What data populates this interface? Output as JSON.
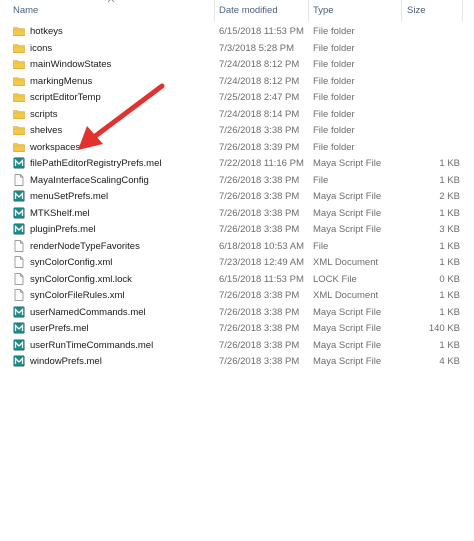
{
  "columns": {
    "name": "Name",
    "date": "Date modified",
    "type": "Type",
    "size": "Size"
  },
  "files": [
    {
      "name": "hotkeys",
      "date": "6/15/2018 11:53 PM",
      "type": "File folder",
      "size": "",
      "icon": "folder-icon"
    },
    {
      "name": "icons",
      "date": "7/3/2018 5:28 PM",
      "type": "File folder",
      "size": "",
      "icon": "folder-icon"
    },
    {
      "name": "mainWindowStates",
      "date": "7/24/2018 8:12 PM",
      "type": "File folder",
      "size": "",
      "icon": "folder-icon"
    },
    {
      "name": "markingMenus",
      "date": "7/24/2018 8:12 PM",
      "type": "File folder",
      "size": "",
      "icon": "folder-icon"
    },
    {
      "name": "scriptEditorTemp",
      "date": "7/25/2018 2:47 PM",
      "type": "File folder",
      "size": "",
      "icon": "folder-icon"
    },
    {
      "name": "scripts",
      "date": "7/24/2018 8:14 PM",
      "type": "File folder",
      "size": "",
      "icon": "folder-icon"
    },
    {
      "name": "shelves",
      "date": "7/26/2018 3:38 PM",
      "type": "File folder",
      "size": "",
      "icon": "folder-icon"
    },
    {
      "name": "workspaces",
      "date": "7/26/2018 3:39 PM",
      "type": "File folder",
      "size": "",
      "icon": "folder-icon"
    },
    {
      "name": "filePathEditorRegistryPrefs.mel",
      "date": "7/22/2018 11:16 PM",
      "type": "Maya Script File",
      "size": "1 KB",
      "icon": "maya-script-icon"
    },
    {
      "name": "MayaInterfaceScalingConfig",
      "date": "7/26/2018 3:38 PM",
      "type": "File",
      "size": "1 KB",
      "icon": "file-icon"
    },
    {
      "name": "menuSetPrefs.mel",
      "date": "7/26/2018 3:38 PM",
      "type": "Maya Script File",
      "size": "2 KB",
      "icon": "maya-script-icon"
    },
    {
      "name": "MTKShelf.mel",
      "date": "7/26/2018 3:38 PM",
      "type": "Maya Script File",
      "size": "1 KB",
      "icon": "maya-script-icon"
    },
    {
      "name": "pluginPrefs.mel",
      "date": "7/26/2018 3:38 PM",
      "type": "Maya Script File",
      "size": "3 KB",
      "icon": "maya-script-icon"
    },
    {
      "name": "renderNodeTypeFavorites",
      "date": "6/18/2018 10:53 AM",
      "type": "File",
      "size": "1 KB",
      "icon": "file-icon"
    },
    {
      "name": "synColorConfig.xml",
      "date": "7/23/2018 12:49 AM",
      "type": "XML Document",
      "size": "1 KB",
      "icon": "file-icon"
    },
    {
      "name": "synColorConfig.xml.lock",
      "date": "6/15/2018 11:53 PM",
      "type": "LOCK File",
      "size": "0 KB",
      "icon": "file-icon"
    },
    {
      "name": "synColorFileRules.xml",
      "date": "7/26/2018 3:38 PM",
      "type": "XML Document",
      "size": "1 KB",
      "icon": "file-icon"
    },
    {
      "name": "userNamedCommands.mel",
      "date": "7/26/2018 3:38 PM",
      "type": "Maya Script File",
      "size": "1 KB",
      "icon": "maya-script-icon"
    },
    {
      "name": "userPrefs.mel",
      "date": "7/26/2018 3:38 PM",
      "type": "Maya Script File",
      "size": "140 KB",
      "icon": "maya-script-icon"
    },
    {
      "name": "userRunTimeCommands.mel",
      "date": "7/26/2018 3:38 PM",
      "type": "Maya Script File",
      "size": "1 KB",
      "icon": "maya-script-icon"
    },
    {
      "name": "windowPrefs.mel",
      "date": "7/26/2018 3:38 PM",
      "type": "Maya Script File",
      "size": "4 KB",
      "icon": "maya-script-icon"
    }
  ],
  "colors": {
    "folder": "#f2c94c",
    "folder_dark": "#d9a82e",
    "maya_icon": "#1d8a8a",
    "arrow": "#e2322f",
    "header_text": "#4c607a"
  }
}
